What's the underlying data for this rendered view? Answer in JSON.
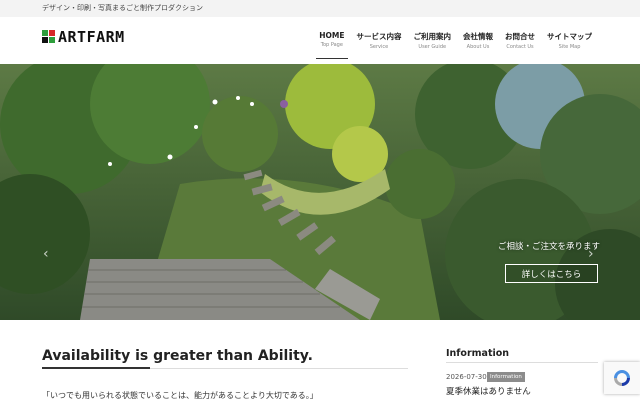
{
  "topbar": {
    "tagline": "デザイン・印刷・写真まるごと制作プロダクション"
  },
  "header": {
    "logo_text": "ARTFARM",
    "logo_colors": [
      "#2e9e3c",
      "#d62828",
      "#2e9e3c",
      "#111111"
    ]
  },
  "nav": {
    "items": [
      {
        "label": "HOME",
        "sub": "Top Page",
        "active": true
      },
      {
        "label": "サービス内容",
        "sub": "Service"
      },
      {
        "label": "ご利用案内",
        "sub": "User Guide"
      },
      {
        "label": "会社情報",
        "sub": "About Us"
      },
      {
        "label": "お問合せ",
        "sub": "Contact Us"
      },
      {
        "label": "サイトマップ",
        "sub": "Site Map"
      }
    ]
  },
  "hero": {
    "caption": "ご相談・ご注文を承ります",
    "button_label": "詳しくはこちら",
    "prev_icon": "chevron-left-icon",
    "next_icon": "chevron-right-icon"
  },
  "main": {
    "heading": "Availability is greater than Ability.",
    "quote": "「いつでも用いられる状態でいることは、能力があることより大切である。」"
  },
  "info": {
    "heading": "Information",
    "items": [
      {
        "date": "2026-07-30",
        "badge": "Information",
        "title": "夏季休業はありません"
      }
    ]
  },
  "colors": {
    "accent": "#333333",
    "badge_bg": "#8c8c8c",
    "topbar_bg": "#f3f3f3"
  }
}
